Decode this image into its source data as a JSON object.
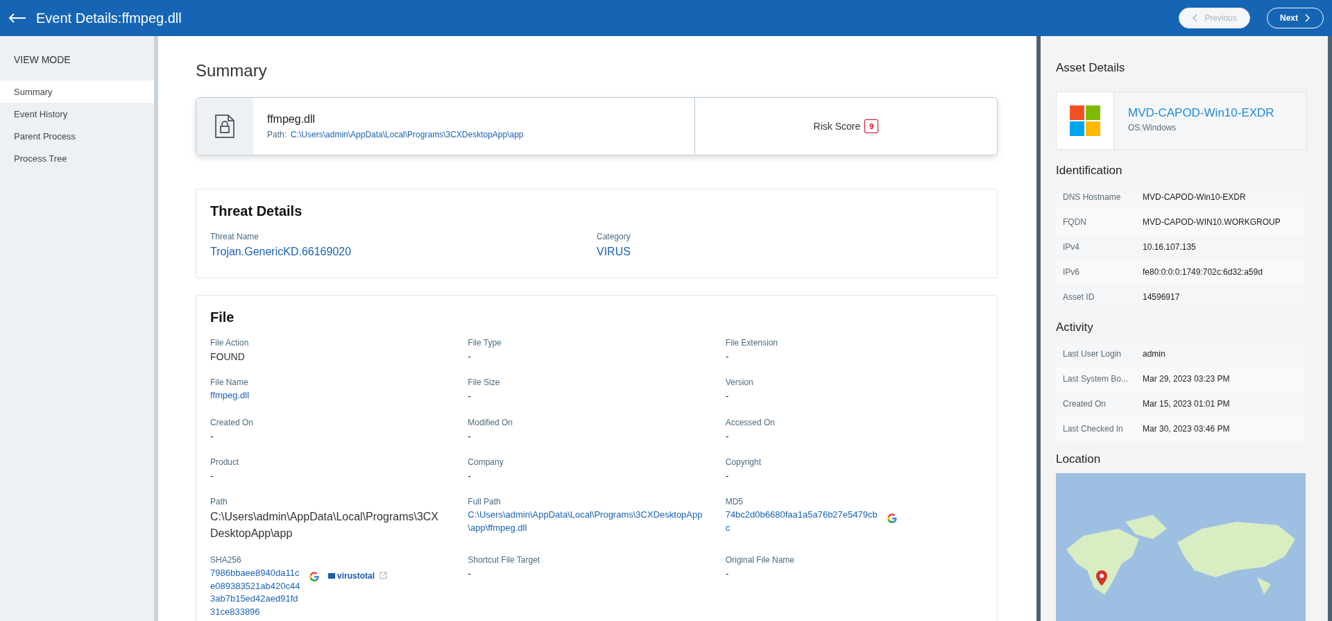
{
  "header": {
    "title": "Event Details:ffmpeg.dll",
    "buttons": [
      {
        "label": "Previous",
        "kind": "prev",
        "disabled": true
      },
      {
        "label": "Next",
        "kind": "next",
        "disabled": false
      }
    ]
  },
  "sidebar": {
    "heading": "VIEW MODE",
    "items": [
      {
        "label": "Summary",
        "selected": true
      },
      {
        "label": "Event History",
        "selected": false
      },
      {
        "label": "Parent Process",
        "selected": false
      },
      {
        "label": "Process Tree",
        "selected": false
      }
    ]
  },
  "summary": {
    "title": "Summary",
    "file_name": "ffmpeg.dll",
    "path_label": "Path:",
    "path": "C:\\Users\\admin\\AppData\\Local\\Programs\\3CXDesktopApp\\app",
    "risk_label": "Risk Score",
    "risk_score": "9"
  },
  "threat_details": {
    "title": "Threat Details",
    "fields": [
      {
        "label": "Threat Name",
        "value": "Trojan.GenericKD.66169020"
      },
      {
        "label": "Category",
        "value": "VIRUS"
      }
    ]
  },
  "file": {
    "title": "File",
    "fields": [
      {
        "label": "File Action",
        "value": "FOUND",
        "kind": "text"
      },
      {
        "label": "File Type",
        "value": "-",
        "kind": "text"
      },
      {
        "label": "File Extension",
        "value": "-",
        "kind": "text"
      },
      {
        "label": "File Name",
        "value": "ffmpeg.dll",
        "kind": "link"
      },
      {
        "label": "File Size",
        "value": "-",
        "kind": "text"
      },
      {
        "label": "Version",
        "value": "-",
        "kind": "text"
      },
      {
        "label": "Created On",
        "value": "-",
        "kind": "text"
      },
      {
        "label": "Modified On",
        "value": "-",
        "kind": "text"
      },
      {
        "label": "Accessed On",
        "value": "-",
        "kind": "text"
      },
      {
        "label": "Product",
        "value": "-",
        "kind": "text"
      },
      {
        "label": "Company",
        "value": "-",
        "kind": "text"
      },
      {
        "label": "Copyright",
        "value": "-",
        "kind": "text"
      },
      {
        "label": "Path",
        "value": "C:\\Users\\admin\\AppData\\Local\\Programs\\3CXDesktopApp\\app",
        "kind": "large"
      },
      {
        "label": "Full Path",
        "value": "C:\\Users\\admin\\AppData\\Local\\Programs\\3CXDesktopApp\\app\\ffmpeg.dll",
        "kind": "link"
      },
      {
        "label": "MD5",
        "value": "74bc2d0b6680faa1a5a76b27e5479cbc",
        "kind": "hash",
        "lookups": [
          {
            "kind": "google"
          }
        ]
      },
      {
        "label": "SHA256",
        "value": "7986bbaee8940da11ce089383521ab420c443ab7b15ed42aed91fd31ce833896",
        "kind": "hash",
        "lookups": [
          {
            "kind": "google"
          },
          {
            "kind": "virustotal",
            "label": "virustotal"
          }
        ]
      },
      {
        "label": "Shortcut File Target",
        "value": "-",
        "kind": "text"
      },
      {
        "label": "Original File Name",
        "value": "-",
        "kind": "text"
      }
    ]
  },
  "asset": {
    "title": "Asset Details",
    "name": "MVD-CAPOD-Win10-EXDR",
    "os": "OS:Windows"
  },
  "identification": {
    "title": "Identification",
    "rows": [
      {
        "label": "DNS Hostname",
        "value": "MVD-CAPOD-Win10-EXDR"
      },
      {
        "label": "FQDN",
        "value": "MVD-CAPOD-WIN10.WORKGROUP"
      },
      {
        "label": "IPv4",
        "value": "10.16.107.135"
      },
      {
        "label": "IPv6",
        "value": "fe80:0:0:0:1749:702c:6d32:a59d"
      },
      {
        "label": "Asset ID",
        "value": "14596917"
      }
    ]
  },
  "activity": {
    "title": "Activity",
    "rows": [
      {
        "label": "Last User Login",
        "value": "admin"
      },
      {
        "label": "Last System Bo...",
        "value": "Mar 29, 2023 03:23 PM"
      },
      {
        "label": "Created On",
        "value": "Mar 15, 2023 01:01 PM"
      },
      {
        "label": "Last Checked In",
        "value": "Mar 30, 2023 03:46 PM"
      }
    ]
  },
  "location": {
    "title": "Location"
  }
}
